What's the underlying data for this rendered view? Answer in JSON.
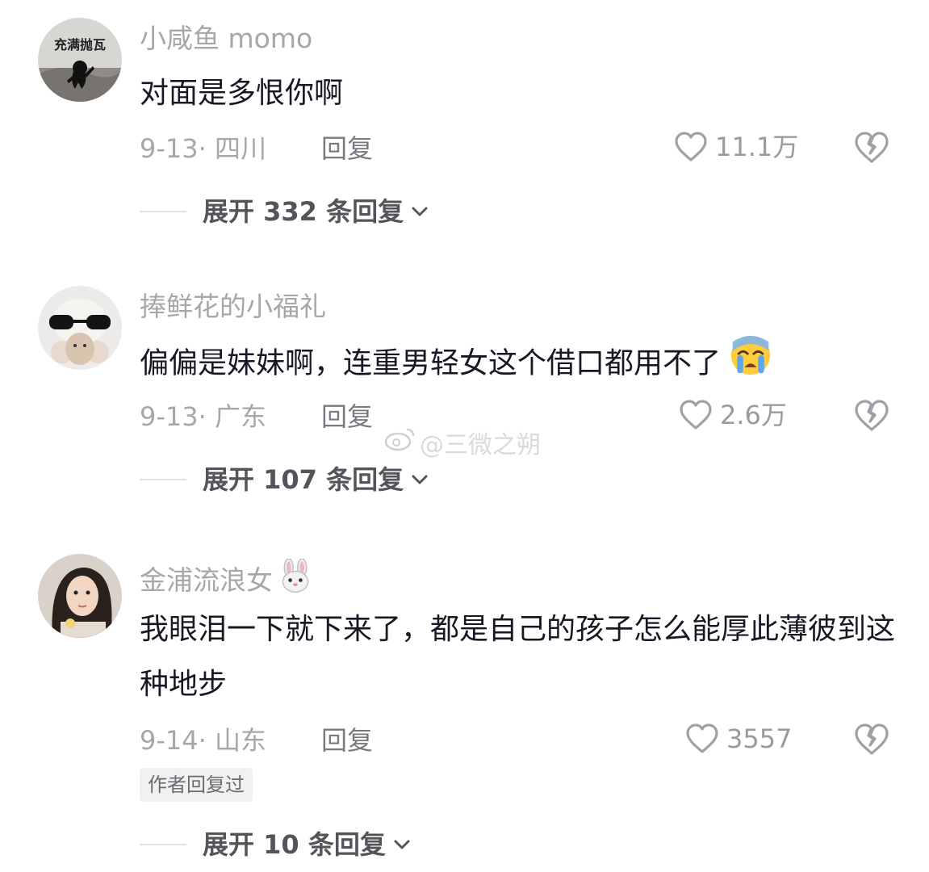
{
  "comments": [
    {
      "username": "小咸鱼 momo",
      "avatar_text": "充满抛瓦",
      "content": "对面是多恨你啊",
      "date_location": "9-13· 四川",
      "reply_label": "回复",
      "likes": "11.1万",
      "expand_label": "展开 332 条回复"
    },
    {
      "username": "捧鲜花的小福礼",
      "content": "偏偏是妹妹啊，连重男轻女这个借口都用不了",
      "content_emoji": "crying-face-emoji",
      "date_location": "9-13· 广东",
      "reply_label": "回复",
      "likes": "2.6万",
      "expand_label": "展开 107 条回复"
    },
    {
      "username": "金浦流浪女",
      "username_emoji": "rabbit-face-emoji",
      "content": "我眼泪一下就下来了，都是自己的孩子怎么能厚此薄彼到这种地步",
      "date_location": "9-14· 山东",
      "reply_label": "回复",
      "likes": "3557",
      "author_badge": "作者回复过",
      "expand_label": "展开 10 条回复"
    }
  ],
  "watermark": "@三微之朔",
  "colors": {
    "text_primary": "#161823",
    "text_secondary": "#a6a7ab",
    "divider": "#e2e2e4",
    "badge_bg": "#f1f1f2"
  }
}
